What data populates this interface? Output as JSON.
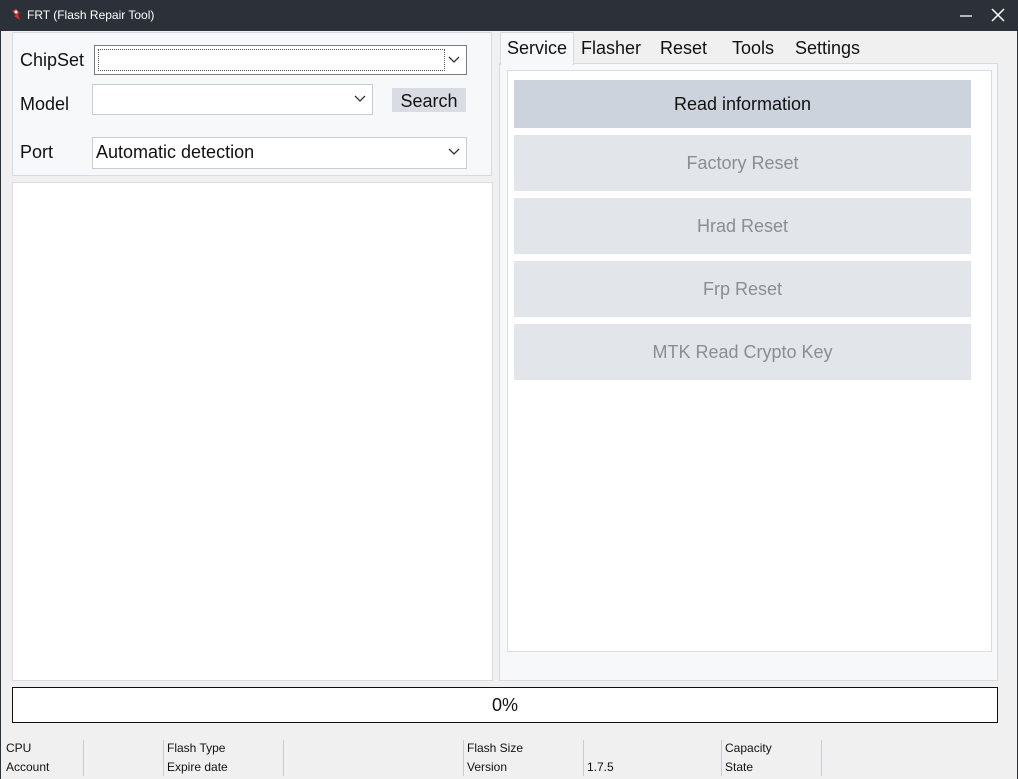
{
  "window": {
    "title": "FRT (Flash Repair Tool)",
    "title_bar_color": "#2c3038"
  },
  "left": {
    "chipset_label": "ChipSet",
    "chipset_value": "",
    "model_label": "Model",
    "model_value": "",
    "search_label": "Search",
    "port_label": "Port",
    "port_value": "Automatic detection"
  },
  "tabs": [
    {
      "label": "Service",
      "active": true
    },
    {
      "label": "Flasher"
    },
    {
      "label": "Reset"
    },
    {
      "label": "Tools"
    },
    {
      "label": "Settings"
    }
  ],
  "service_buttons": [
    {
      "label": "Read information",
      "enabled": true
    },
    {
      "label": "Factory Reset",
      "enabled": false
    },
    {
      "label": "Hrad Reset",
      "enabled": false
    },
    {
      "label": "Frp Reset",
      "enabled": false
    },
    {
      "label": "MTK Read Crypto Key",
      "enabled": false
    }
  ],
  "progress": {
    "text": "0%",
    "value": 0
  },
  "status": {
    "cpu_label": "CPU",
    "account_label": "Account",
    "flash_type_label": "Flash Type",
    "expire_date_label": "Expire date",
    "flash_size_label": "Flash Size",
    "version_label": "Version",
    "version_value": "1.7.5",
    "capacity_label": "Capacity",
    "state_label": "State"
  }
}
